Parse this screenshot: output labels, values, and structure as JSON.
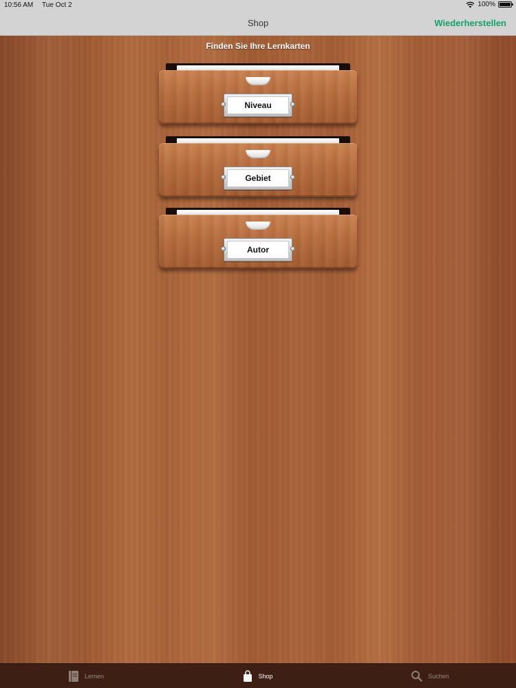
{
  "status_bar": {
    "time": "10:56 AM",
    "date": "Tue Oct 2",
    "battery": "100%",
    "wifi_icon": "wifi-icon"
  },
  "nav_bar": {
    "title": "Shop",
    "action_label": "Wiederherstellen",
    "action_color": "#12a36a"
  },
  "main": {
    "heading": "Finden Sie Ihre Lernkarten",
    "drawers": [
      {
        "label": "Niveau"
      },
      {
        "label": "Gebiet"
      },
      {
        "label": "Autor"
      }
    ]
  },
  "tab_bar": {
    "tabs": [
      {
        "label": "Lernen",
        "icon": "book-icon",
        "active": false
      },
      {
        "label": "Shop",
        "icon": "shopping-bag-icon",
        "active": true
      },
      {
        "label": "Suchen",
        "icon": "search-icon",
        "active": false
      }
    ]
  }
}
